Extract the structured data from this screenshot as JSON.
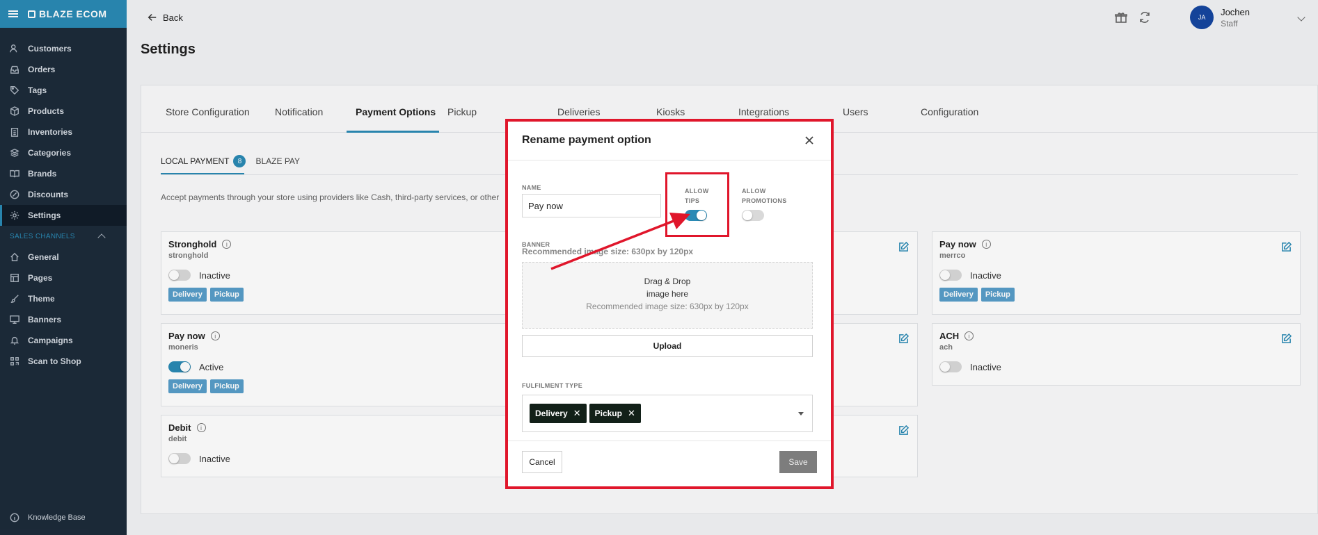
{
  "sidebar": {
    "brand": "BLAZE ECOM",
    "items": [
      {
        "label": "Customers",
        "icon": "users-icon"
      },
      {
        "label": "Orders",
        "icon": "inbox-icon"
      },
      {
        "label": "Tags",
        "icon": "tag-icon"
      },
      {
        "label": "Products",
        "icon": "package-icon"
      },
      {
        "label": "Inventories",
        "icon": "clipboard-icon"
      },
      {
        "label": "Categories",
        "icon": "layers-icon"
      },
      {
        "label": "Brands",
        "icon": "book-icon"
      },
      {
        "label": "Discounts",
        "icon": "percent-icon"
      },
      {
        "label": "Settings",
        "icon": "gear-icon"
      }
    ],
    "section_label": "SALES CHANNELS",
    "channel_items": [
      {
        "label": "General",
        "icon": "home-icon"
      },
      {
        "label": "Pages",
        "icon": "layout-icon"
      },
      {
        "label": "Theme",
        "icon": "brush-icon"
      },
      {
        "label": "Banners",
        "icon": "monitor-icon"
      },
      {
        "label": "Campaigns",
        "icon": "bell-icon"
      },
      {
        "label": "Scan to Shop",
        "icon": "qr-icon"
      }
    ],
    "knowledge_base": "Knowledge Base"
  },
  "topbar": {
    "back_label": "Back",
    "user_initials": "JA",
    "user_name": "Jochen",
    "user_role": "Staff"
  },
  "page": {
    "title": "Settings",
    "tabs": [
      "Store Configuration",
      "Notification",
      "Payment Options",
      "Pickup",
      "Deliveries",
      "Kiosks",
      "Integrations",
      "Users",
      "Configuration"
    ],
    "subtabs": {
      "local": "LOCAL PAYMENT",
      "local_count": "8",
      "blaze": "BLAZE PAY"
    },
    "description": "Accept payments through your store using providers like Cash, third-party services, or other"
  },
  "payment_cards": [
    {
      "name": "Stronghold",
      "id": "stronghold",
      "status": "Inactive",
      "tags": [
        "Delivery",
        "Pickup"
      ]
    },
    {
      "name": "Pay now",
      "id": "moneris",
      "status": "Active",
      "tags": [
        "Delivery",
        "Pickup"
      ]
    },
    {
      "name": "Debit",
      "id": "debit",
      "status": "Inactive",
      "tags": []
    },
    {
      "name": "Pay now",
      "id": "merrco",
      "status": "Inactive",
      "tags": [
        "Delivery",
        "Pickup"
      ]
    },
    {
      "name": "ACH",
      "id": "ach",
      "status": "Inactive",
      "tags": []
    }
  ],
  "modal": {
    "title": "Rename payment option",
    "name_label": "NAME",
    "name_value": "Pay now",
    "allow_tips_label": "ALLOW TIPS",
    "allow_tips": true,
    "allow_promotions_label": "ALLOW PROMOTIONS",
    "allow_promotions": false,
    "banner_label": "BANNER",
    "banner_note": "Recommended image size: 630px by 120px",
    "drop_line1": "Drag & Drop",
    "drop_line2": "image here",
    "drop_line3": "Recommended image size: 630px by 120px",
    "upload_label": "Upload",
    "fulfilment_label": "FULFILMENT TYPE",
    "fulfilment_chips": [
      "Delivery",
      "Pickup"
    ],
    "cancel_label": "Cancel",
    "save_label": "Save"
  },
  "colors": {
    "accent": "#2a8ab5",
    "sidebar_bg": "#1d2b3a",
    "highlight_red": "#e0162b"
  }
}
